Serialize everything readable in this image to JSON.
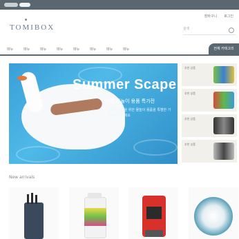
{
  "header": {
    "brand": "TOMIBOX",
    "top_links": [
      "장바구니",
      "로그인"
    ],
    "search_placeholder": "검색"
  },
  "nav": {
    "items": [
      "메뉴",
      "메뉴",
      "메뉴",
      "메뉴",
      "메뉴",
      "메뉴",
      "메뉴",
      "메뉴"
    ],
    "cta_label": "전체 카테고리"
  },
  "banner": {
    "title": "Summer Scape",
    "subtitle": "여름 물놀이 용품 특가전",
    "description": "시원한 여름을 위한 물놀이 용품을 특별한 가격에 만나보세요"
  },
  "side_promos": [
    {
      "label": "추천 상품"
    },
    {
      "label": "추천 상품"
    },
    {
      "label": "추천 상품"
    },
    {
      "label": "추천 상품"
    }
  ],
  "new_arrivals": {
    "title": "New arrivals",
    "products": [
      {
        "icon": "knife-block-icon"
      },
      {
        "icon": "supplement-bottle-icon"
      },
      {
        "icon": "coffee-machine-icon"
      },
      {
        "icon": "patterned-plate-icon"
      }
    ]
  },
  "colors": {
    "accent": "#5a6670",
    "banner": "#3a9fd9"
  }
}
